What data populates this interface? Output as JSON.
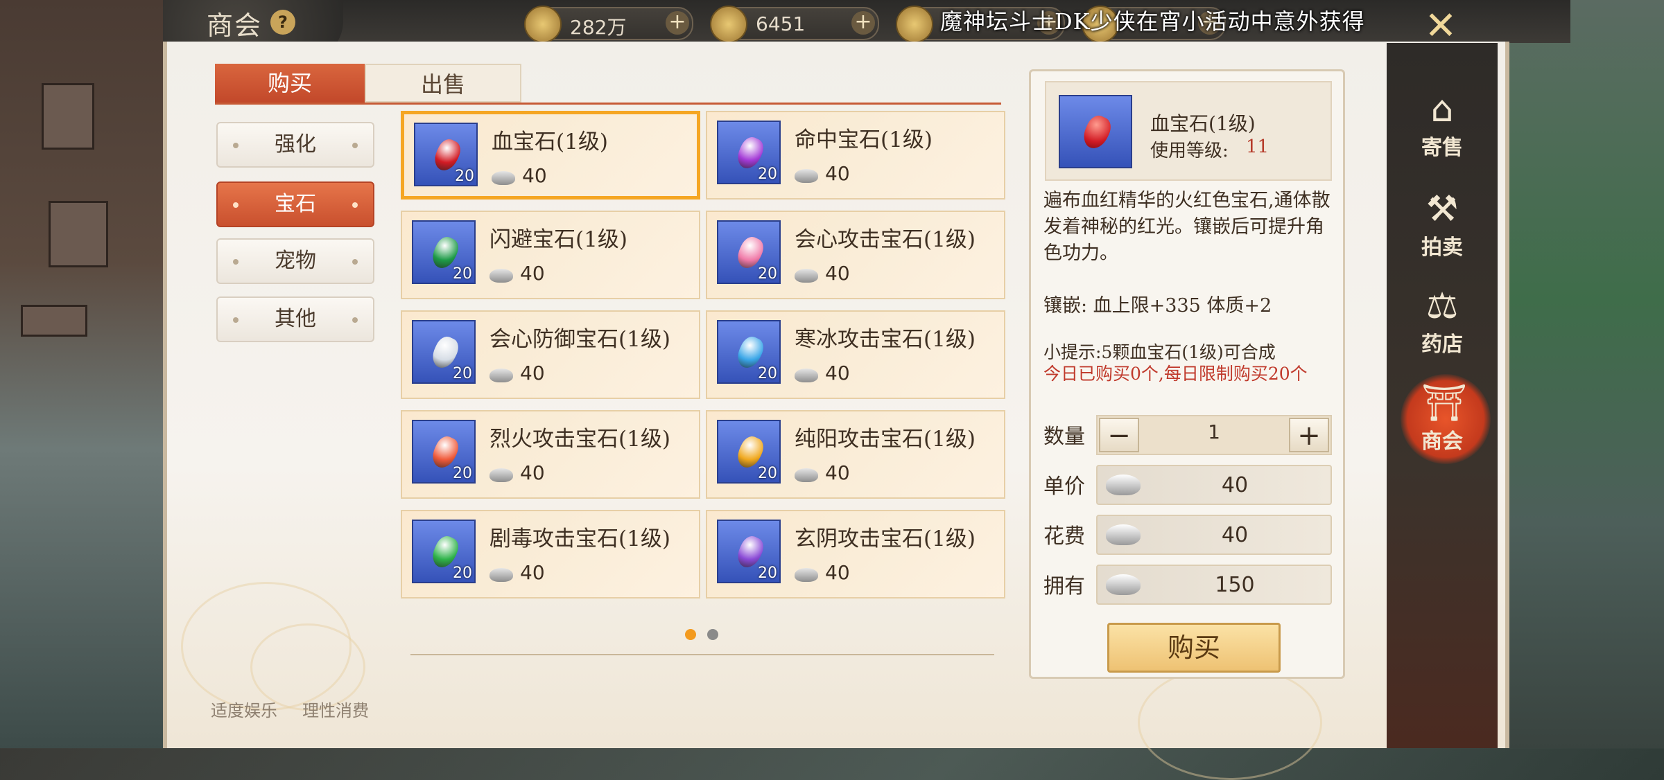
{
  "window": {
    "title": "商会",
    "help_icon": "?"
  },
  "currencies": [
    {
      "icon": "copper-coin-icon",
      "value": "282万"
    },
    {
      "icon": "gold-coin-icon",
      "value": "6451"
    },
    {
      "icon": "gold-ingot-icon",
      "value": ""
    },
    {
      "icon": "currency-icon",
      "value": ""
    }
  ],
  "marquee": "魔神坛斗士DK少侠在宵小活动中意外获得",
  "tabs": [
    {
      "label": "购买"
    },
    {
      "label": "出售"
    }
  ],
  "categories": [
    {
      "label": "强化"
    },
    {
      "label": "宝石"
    },
    {
      "label": "宠物"
    },
    {
      "label": "其他"
    }
  ],
  "items": [
    {
      "name": "血宝石(1级)",
      "count": "20",
      "price": "40",
      "color": "#d21b24"
    },
    {
      "name": "命中宝石(1级)",
      "count": "20",
      "price": "40",
      "color": "#a33ad6"
    },
    {
      "name": "闪避宝石(1级)",
      "count": "20",
      "price": "40",
      "color": "#1e9b48"
    },
    {
      "name": "会心攻击宝石(1级)",
      "count": "20",
      "price": "40",
      "color": "#f07aa8"
    },
    {
      "name": "会心防御宝石(1级)",
      "count": "20",
      "price": "40",
      "color": "#d6dde6"
    },
    {
      "name": "寒冰攻击宝石(1级)",
      "count": "20",
      "price": "40",
      "color": "#3aa6e8"
    },
    {
      "name": "烈火攻击宝石(1级)",
      "count": "20",
      "price": "40",
      "color": "#f05a3a"
    },
    {
      "name": "纯阳攻击宝石(1级)",
      "count": "20",
      "price": "40",
      "color": "#f0a81e"
    },
    {
      "name": "剧毒攻击宝石(1级)",
      "count": "20",
      "price": "40",
      "color": "#2fb34a"
    },
    {
      "name": "玄阴攻击宝石(1级)",
      "count": "20",
      "price": "40",
      "color": "#8a4ad6"
    }
  ],
  "pagination": {
    "current": 1,
    "total": 2
  },
  "footer": {
    "left": "适度娱乐",
    "right": "理性消费"
  },
  "detail": {
    "name": "血宝石(1级)",
    "level_label": "使用等级:",
    "level_value": "11",
    "description": "遍布血红精华的火红色宝石,通体散发着神秘的红光。镶嵌后可提升角色功力。",
    "inlay": "镶嵌:  血上限+335    体质+2",
    "tip": "小提示:5颗血宝石(1级)可合成",
    "limit": "今日已购买0个,每日限制购买20个",
    "qty_label": "数量",
    "qty_value": "1",
    "unit_label": "单价",
    "unit_value": "40",
    "cost_label": "花费",
    "cost_value": "40",
    "own_label": "拥有",
    "own_value": "150",
    "buy_label": "购买"
  },
  "sidenav": [
    {
      "label": "寄售",
      "icon": "pavilion-icon"
    },
    {
      "label": "拍卖",
      "icon": "gavel-icon"
    },
    {
      "label": "药店",
      "icon": "scale-icon"
    },
    {
      "label": "商会",
      "icon": "shop-icon"
    }
  ]
}
